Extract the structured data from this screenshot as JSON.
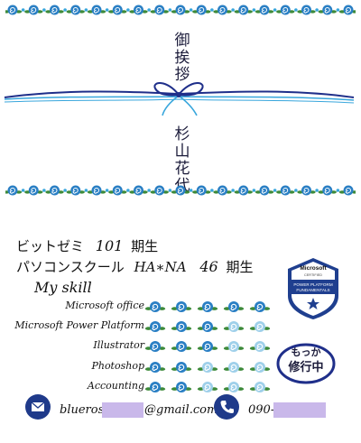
{
  "card": {
    "greeting": [
      "御",
      "挨",
      "拶"
    ],
    "name": [
      "杉",
      "山",
      "花",
      "代"
    ]
  },
  "profile": {
    "school1_prefix": "ビットゼミ",
    "school1_number": "101",
    "school1_suffix": "期生",
    "school2_prefix": "パソコンスクール",
    "school2_name": "HA∗NA",
    "school2_number": "46",
    "school2_suffix": "期生",
    "skill_heading": "My skill"
  },
  "skills": [
    {
      "label": "Microsoft office",
      "level": 5,
      "max": 5
    },
    {
      "label": "Microsoft Power Platform",
      "level": 3,
      "max": 5
    },
    {
      "label": "Illustrator",
      "level": 3,
      "max": 5
    },
    {
      "label": "Photoshop",
      "level": 2,
      "max": 5
    },
    {
      "label": "Accounting",
      "level": 2,
      "max": 5
    }
  ],
  "badge": {
    "brand": "Microsoft",
    "certified": "CERTIFIED",
    "line1": "POWER PLATFORM",
    "line2": "FUNDAMENTALS"
  },
  "stamp": {
    "line1": "もっか",
    "line2": "修行中"
  },
  "contact": {
    "email_user": "bluerose.",
    "email_domain": "@gmail.com",
    "phone_prefix": "090-"
  },
  "colors": {
    "rose_dark": "#2a7fc4",
    "rose_light": "#9fd0ea",
    "leaf": "#3d8a3a",
    "ribbon_dark": "#1f2f8a",
    "ribbon_light": "#38a6dc",
    "badge_blue": "#1f3f8f",
    "mask": "#c9b8ea"
  },
  "icons": {
    "mail": "mail-icon",
    "phone": "phone-icon",
    "rose": "rose-icon",
    "star": "star-icon"
  }
}
